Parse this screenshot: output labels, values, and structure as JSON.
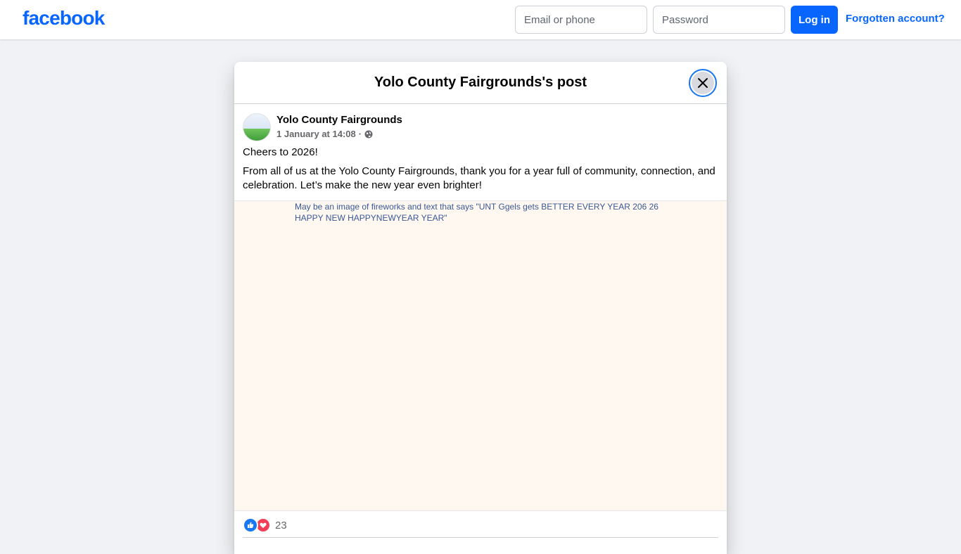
{
  "header": {
    "logo": "facebook",
    "email_placeholder": "Email or phone",
    "password_placeholder": "Password",
    "login_label": "Log in",
    "forgot_label": "Forgotten account?"
  },
  "dialog": {
    "title": "Yolo County Fairgrounds's post",
    "post": {
      "author": "Yolo County Fairgrounds",
      "timestamp": "1 January at 14:08",
      "separator": "·",
      "text_line1": "Cheers to 2026!",
      "text_line2": "From all of us at the Yolo County Fairgrounds, thank you for a year full of community, connection, and celebration. Let’s make the new year even brighter!",
      "image_alt": "May be an image of fireworks and text that says \"UNT Ggels gets BETTER EVERY YEAR 206 26 HAPPY NEW HAPPYNEWYEAR YEAR\"",
      "reaction_count": "23"
    }
  },
  "colors": {
    "brand": "#0866ff",
    "background": "#f0f2f5",
    "like": "#1877f2",
    "love": "#f33e58"
  },
  "icons": [
    "close-icon",
    "globe-icon",
    "like-icon",
    "love-icon"
  ]
}
